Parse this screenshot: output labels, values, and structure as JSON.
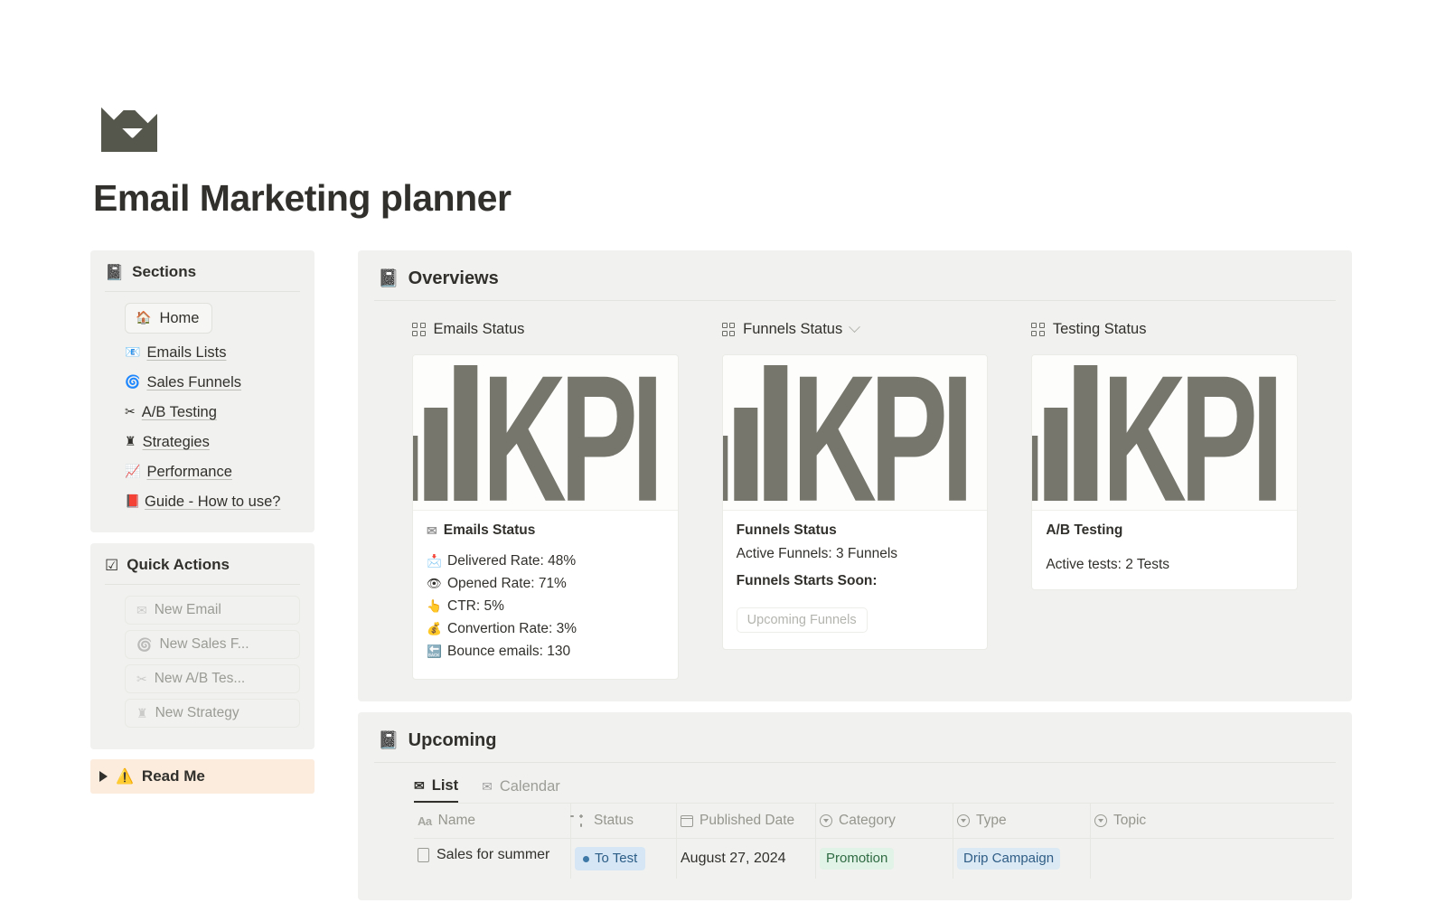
{
  "header": {
    "icon": "envelope-icon",
    "title": "Email Marketing planner"
  },
  "sidebar": {
    "sections_panel": {
      "icon": "📓",
      "title": "Sections",
      "items": [
        {
          "icon": "🏠",
          "label": "Home",
          "active": true
        },
        {
          "icon": "📧",
          "label": "Emails Lists"
        },
        {
          "icon": "🌀",
          "label": "Sales Funnels"
        },
        {
          "icon": "✂",
          "label": "A/B Testing"
        },
        {
          "icon": "♜",
          "label": "Strategies"
        },
        {
          "icon": "📈",
          "label": "Performance"
        },
        {
          "icon": "📕",
          "label": "Guide - How to use?"
        }
      ]
    },
    "quick_actions_panel": {
      "icon": "☑",
      "title": "Quick Actions",
      "buttons": [
        {
          "icon": "✉",
          "label": "New Email"
        },
        {
          "icon": "🌀",
          "label": "New Sales F..."
        },
        {
          "icon": "✂",
          "label": "New A/B Tes..."
        },
        {
          "icon": "♜",
          "label": "New Strategy"
        }
      ]
    },
    "read_me": {
      "icon": "⚠️",
      "label": "Read Me"
    }
  },
  "main": {
    "overviews": {
      "icon": "📓",
      "title": "Overviews",
      "cards": [
        {
          "label": "Emails Status",
          "has_chevron": false,
          "image_alt": "KPI bar chart graphic",
          "title_icon": "✉",
          "title": "Emails Status",
          "subtitle": "",
          "stats": [
            {
              "icon": "📩",
              "text": "Delivered Rate: 48%"
            },
            {
              "icon": "👁",
              "text": "Opened Rate: 71%"
            },
            {
              "icon": "👆",
              "text": "CTR: 5%"
            },
            {
              "icon": "💰",
              "text": "Convertion Rate: 3%"
            },
            {
              "icon": "🔙",
              "text": "Bounce emails: 130"
            }
          ],
          "pill": ""
        },
        {
          "label": "Funnels Status",
          "has_chevron": true,
          "image_alt": "KPI bar chart graphic",
          "title_icon": "",
          "title": "Funnels Status",
          "subtitle": "Active Funnels: 3 Funnels",
          "section_label": "Funnels Starts Soon:",
          "stats": [],
          "pill": "Upcoming Funnels"
        },
        {
          "label": "Testing Status",
          "has_chevron": false,
          "image_alt": "KPI bar chart graphic",
          "title_icon": "",
          "title": "A/B Testing",
          "subtitle": "Active tests: 2 Tests",
          "stats": [],
          "pill": ""
        }
      ]
    },
    "upcoming": {
      "icon": "📓",
      "title": "Upcoming",
      "tabs": [
        {
          "icon": "✉",
          "label": "List",
          "active": true
        },
        {
          "icon": "✉",
          "label": "Calendar",
          "active": false
        }
      ],
      "table": {
        "columns": [
          {
            "icon": "aa-icon",
            "label": "Name"
          },
          {
            "icon": "spinner-icon",
            "label": "Status"
          },
          {
            "icon": "calendar-icon",
            "label": "Published Date"
          },
          {
            "icon": "select-icon",
            "label": "Category"
          },
          {
            "icon": "select-icon",
            "label": "Type"
          },
          {
            "icon": "select-icon",
            "label": "Topic"
          }
        ],
        "rows": [
          {
            "name": "Sales for summer",
            "status": "To Test",
            "published_date": "August 27, 2024",
            "category": "Promotion",
            "type": "Drip Campaign",
            "topic": ""
          }
        ]
      }
    }
  },
  "kpi_graphic": {
    "word": "KPI",
    "bars": [
      72,
      103,
      150
    ]
  },
  "colors": {
    "accent_dark": "#55564c",
    "panel_bg": "#f1f1ef",
    "readme_bg": "#fbecdd",
    "status_blue_bg": "#d6e6f5",
    "category_green_bg": "#e1f2e6",
    "type_blue_bg": "#dbe9f5",
    "kpi_gray": "#76766d"
  }
}
